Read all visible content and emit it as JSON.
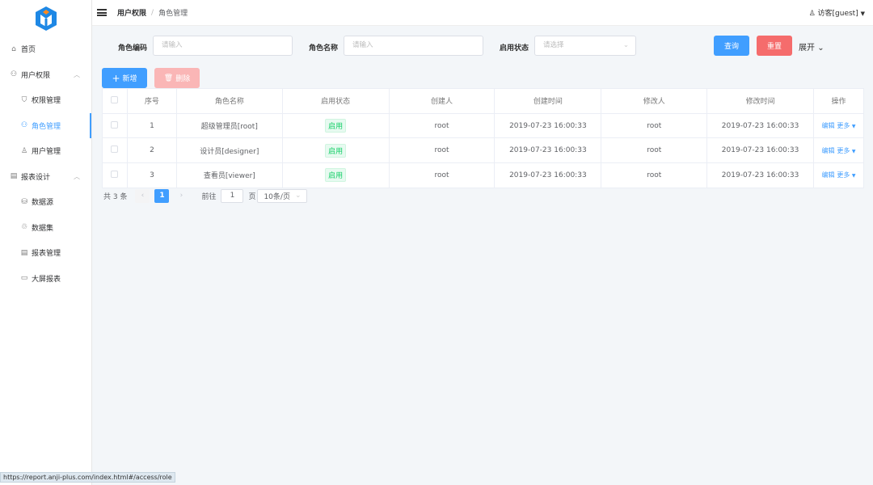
{
  "sidebar": {
    "items": [
      {
        "label": "首页",
        "icon": "⌂",
        "sub": false
      },
      {
        "label": "用户权限",
        "icon": "⚇",
        "sub": false,
        "arrow": "︿"
      },
      {
        "label": "权限管理",
        "icon": "⛉",
        "sub": true
      },
      {
        "label": "角色管理",
        "icon": "⚇",
        "sub": true,
        "active": true
      },
      {
        "label": "用户管理",
        "icon": "♙",
        "sub": true
      },
      {
        "label": "报表设计",
        "icon": "▤",
        "sub": false,
        "arrow": "︿"
      },
      {
        "label": "数据源",
        "icon": "⛁",
        "sub": true
      },
      {
        "label": "数据集",
        "icon": "♲",
        "sub": true
      },
      {
        "label": "报表管理",
        "icon": "▤",
        "sub": true
      },
      {
        "label": "大屏报表",
        "icon": "▭",
        "sub": true
      }
    ]
  },
  "header": {
    "crumb1": "用户权限",
    "sep": "/",
    "crumb2": "角色管理",
    "user": "访客[guest]"
  },
  "form": {
    "code_label": "角色编码",
    "code_ph": "请输入",
    "name_label": "角色名称",
    "name_ph": "请输入",
    "status_label": "启用状态",
    "status_ph": "请选择",
    "query": "查询",
    "reset": "重置",
    "expand": "展开"
  },
  "toolbar": {
    "add": "新增",
    "delete": "删除"
  },
  "table": {
    "headers": [
      "序号",
      "角色名称",
      "启用状态",
      "创建人",
      "创建时间",
      "修改人",
      "修改时间",
      "操作"
    ],
    "rows": [
      {
        "no": "1",
        "name": "超级管理员[root]",
        "status": "启用",
        "creator": "root",
        "created": "2019-07-23 16:00:33",
        "modifier": "root",
        "modified": "2019-07-23 16:00:33"
      },
      {
        "no": "2",
        "name": "设计员[designer]",
        "status": "启用",
        "creator": "root",
        "created": "2019-07-23 16:00:33",
        "modifier": "root",
        "modified": "2019-07-23 16:00:33"
      },
      {
        "no": "3",
        "name": "查看员[viewer]",
        "status": "启用",
        "creator": "root",
        "created": "2019-07-23 16:00:33",
        "modifier": "root",
        "modified": "2019-07-23 16:00:33"
      }
    ],
    "edit": "编辑",
    "more": "更多"
  },
  "pager": {
    "total": "共 3 条",
    "page": "1",
    "goto": "前往",
    "goto_val": "1",
    "page_unit": "页",
    "size": "10条/页"
  },
  "statusbar": "https://report.anji-plus.com/index.html#/access/role",
  "colors": {
    "primary": "#409eff",
    "danger": "#f56c6c",
    "success": "#13ce66"
  }
}
